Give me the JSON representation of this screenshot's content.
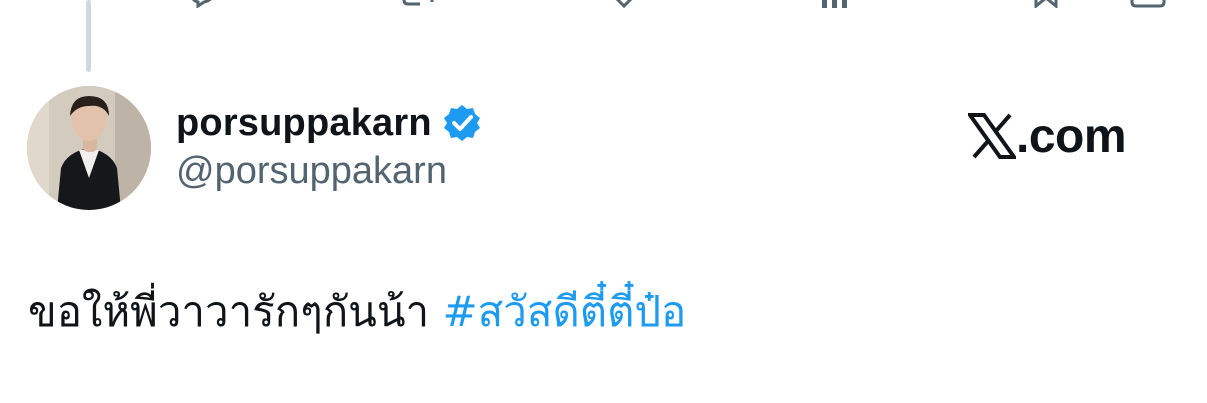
{
  "colors": {
    "text_primary": "#0f1419",
    "text_secondary": "#536471",
    "link": "#1d9bf0",
    "verified_badge": "#1d9bf0",
    "thread_line": "#cfd9de"
  },
  "previous_post": {
    "actions": [
      {
        "icon": "reply-icon"
      },
      {
        "icon": "retweet-icon"
      },
      {
        "icon": "like-icon"
      },
      {
        "icon": "views-icon"
      },
      {
        "icon": "bookmark-icon"
      },
      {
        "icon": "share-icon"
      }
    ]
  },
  "post": {
    "author": {
      "display_name": "porsuppakarn",
      "handle": "@porsuppakarn",
      "verified": true,
      "avatar_icon": "profile-photo"
    },
    "brand": {
      "icon": "x-logo-icon",
      "text": ".com"
    },
    "text": {
      "body": "ขอให้พี่วาวารักๆกันน้า ",
      "hashtag": "#สวัสดีตี๋ตี๋ป๋อ"
    }
  }
}
